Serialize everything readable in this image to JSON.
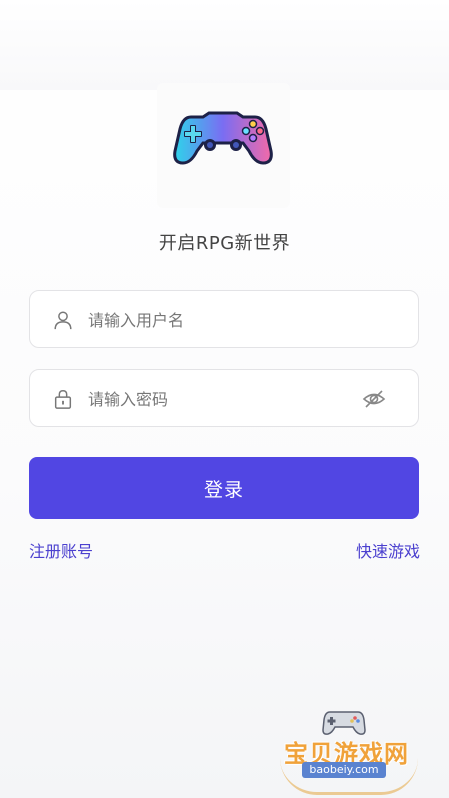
{
  "app": {
    "tagline": "开启RPG新世界",
    "logo_icon": "gamepad-icon"
  },
  "form": {
    "username": {
      "placeholder": "请输入用户名",
      "value": "",
      "icon": "user-icon"
    },
    "password": {
      "placeholder": "请输入密码",
      "value": "",
      "icon": "lock-icon",
      "toggle_icon": "eye-off-icon"
    },
    "login_label": "登录"
  },
  "links": {
    "register": "注册账号",
    "quick_play": "快速游戏"
  },
  "watermark": {
    "title": "宝贝游戏网",
    "url": "baobeiy.com"
  },
  "colors": {
    "primary": "#5146e3",
    "link": "#4b40cf"
  }
}
